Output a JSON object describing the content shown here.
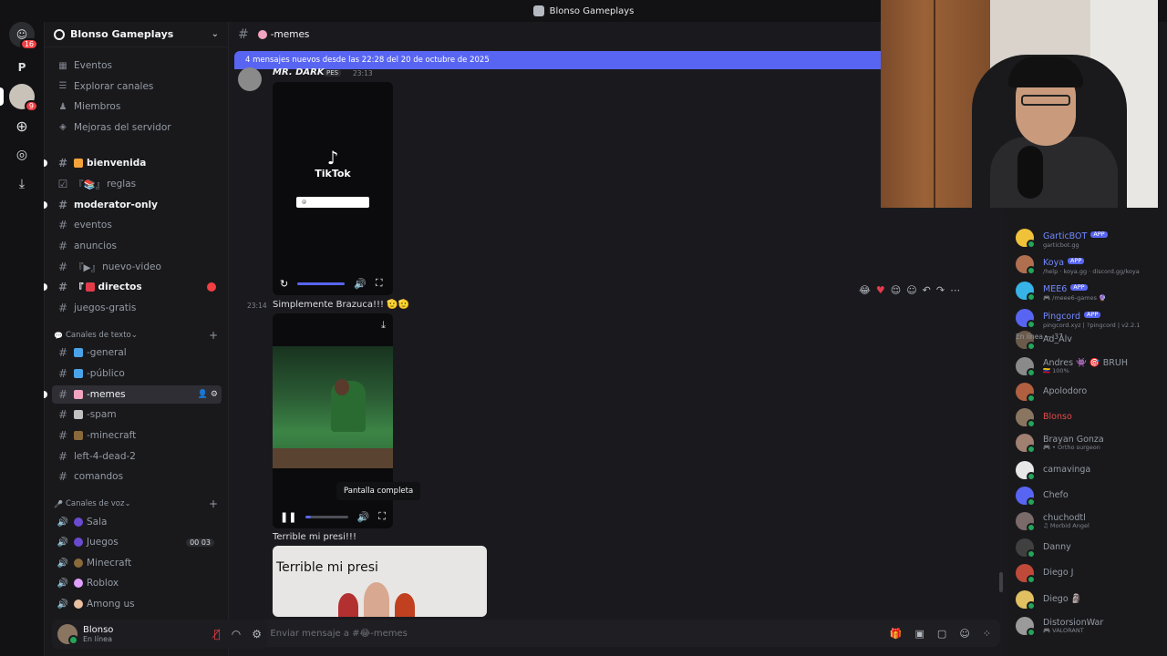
{
  "window": {
    "title": "Blonso Gameplays"
  },
  "rail": {
    "dm_badge": "16",
    "server_badge": "9",
    "p_label": "P"
  },
  "server": {
    "name": "Blonso Gameplays"
  },
  "sidebar_top": [
    {
      "label": "Eventos",
      "icon": "calendar-icon"
    },
    {
      "label": "Explorar canales",
      "icon": "channels-icon"
    },
    {
      "label": "Miembros",
      "icon": "members-icon"
    },
    {
      "label": "Mejoras del servidor",
      "icon": "boost-icon"
    }
  ],
  "channels_top": [
    {
      "label": "bienvenida",
      "bold": true,
      "emoji_color": "#f4a23a"
    },
    {
      "label": "reglas",
      "prefix": "『📚』",
      "checkbox": true
    },
    {
      "label": "moderator-only",
      "bold": true
    },
    {
      "label": "eventos"
    },
    {
      "label": "anuncios"
    },
    {
      "label": "nuevo-video",
      "prefix": "『▶』"
    },
    {
      "label": "directos",
      "prefix": "『",
      "bold": true,
      "emoji_color": "#e23b4a"
    },
    {
      "label": "juegos-gratis"
    }
  ],
  "text_category": {
    "label": "Canales de texto"
  },
  "text_channels": [
    {
      "label": "-general",
      "emoji_color": "#4aa3e8"
    },
    {
      "label": "-público",
      "emoji_color": "#4aa3e8"
    },
    {
      "label": "-memes",
      "emoji_color": "#f2a3c0",
      "active": true
    },
    {
      "label": "-spam",
      "emoji_color": "#c0c0c0"
    },
    {
      "label": "-minecraft",
      "emoji_color": "#8a6a3a"
    },
    {
      "label": "left-4-dead-2"
    },
    {
      "label": "comandos"
    }
  ],
  "voice_category": {
    "label": "Canales de voz"
  },
  "voice_channels": [
    {
      "label": "Sala",
      "emoji_color": "#6a4ad0"
    },
    {
      "label": "Juegos",
      "emoji_color": "#6a4ad0",
      "count_a": "00",
      "count_b": "03"
    },
    {
      "label": "Minecraft",
      "emoji_color": "#8a6a3a"
    },
    {
      "label": "Roblox",
      "emoji_color": "#e0a0ff"
    },
    {
      "label": "Among us",
      "emoji_color": "#e8c0a0"
    }
  ],
  "user": {
    "name": "Blonso",
    "status": "En línea"
  },
  "chat": {
    "channel": "-memes",
    "new_messages": "4 mensajes nuevos desde las 22:28 del 20 de octubre de 2025",
    "author": "MR. DARK",
    "author_tag": "PES",
    "author_time": "23:13",
    "tiktok_label": "TikTok",
    "tiktok_search": "@ ",
    "msg2_time": "23:14",
    "msg2_text": "Simplemente Brazuca!!! 🫡🫡",
    "tooltip": "Pantalla completa",
    "msg3_text": "Terrible mi presi!!!",
    "meme_caption": "Terrible mi presi",
    "composer_placeholder": "Enviar mensaje a #😂-memes"
  },
  "members": {
    "bots": [
      {
        "name": "GarticBOT",
        "sub": "garticbot.gg",
        "color": "#f0c23a"
      },
      {
        "name": "Koya",
        "sub": "/help · koya.gg · discord.gg/koya",
        "color": "#b07050"
      },
      {
        "name": "MEE6",
        "sub": "🎮 /meee6-games 🔮",
        "color": "#37b3e8"
      },
      {
        "name": "Pingcord",
        "sub": "pingcord.xyz | ?pingcord | v2.2.1",
        "color": "#5865f2"
      }
    ],
    "app_tag": "APP",
    "online_label": "En línea — 37",
    "online": [
      {
        "name": "Ad_Alv",
        "sub": "",
        "color": "#6a5a4a"
      },
      {
        "name": "Andres 👾 🎯 BRUH",
        "sub": "🇻🇪 100%",
        "color": "#8a8a8a"
      },
      {
        "name": "Apolodoro",
        "sub": "",
        "color": "#b06040"
      },
      {
        "name": "Blonso",
        "sub": "",
        "color": "#8a7660",
        "red": true
      },
      {
        "name": "Brayan Gonza",
        "sub": "🎮 • Ortho surgeon",
        "color": "#a08070"
      },
      {
        "name": "camavinga",
        "sub": "",
        "color": "#e8e8e8"
      },
      {
        "name": "Chefo",
        "sub": "",
        "color": "#5865f2"
      },
      {
        "name": "chuchodtl",
        "sub": "♫ Morbid Angel",
        "color": "#7a6a6a"
      },
      {
        "name": "Danny",
        "sub": "",
        "color": "#404040"
      },
      {
        "name": "Diego J",
        "sub": "",
        "color": "#c04a3a"
      },
      {
        "name": "Diego 🗿",
        "sub": "",
        "color": "#e0c060"
      },
      {
        "name": "DistorsionWar",
        "sub": "🎮 VALORANT",
        "color": "#9a9a9a"
      }
    ]
  }
}
